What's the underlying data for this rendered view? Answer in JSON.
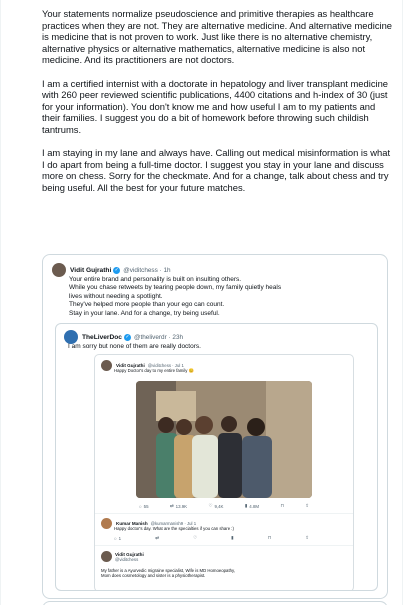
{
  "post": {
    "paragraphs": [
      "Your statements normalize pseudoscience and primitive therapies as healthcare practices when they are not. They are alternative medicine. And alternative medicine is medicine that is not proven to work. Just like there is no alternative chemistry, alternative physics or alternative mathematics, alternative medicine is also not medicine. And its practitioners are not doctors.",
      "I am a certified internist with a doctorate in hepatology and liver transplant medicine with 260 peer reviewed scientific publications, 4400 citations and h-index of 30 (just for your information). You don't know me and how useful I am to my patients and their families. I suggest you do a bit of homework before throwing such childish tantrums.",
      "I am staying in my lane and always have. Calling out medical misinformation is what I do apart from being a full-time doctor. I suggest you stay in your lane and discuss more on chess. Sorry for the checkmate. And for a change, talk about chess and try being useful. All the best for your future matches."
    ]
  },
  "quote": {
    "author": "Vidit Gujrathi",
    "handle": "@viditchess · 1h",
    "lines": [
      "Your entire brand and personality is built on insulting others.",
      "While you chase retweets by tearing people down, my family quietly heals",
      "lives without needing a spotlight.",
      "They've helped more people than your ego can count.",
      "Stay in your lane. And for a change, try being useful."
    ]
  },
  "inner": {
    "author": "TheLiverDoc",
    "handle": "@theliverdr · 23h",
    "text": "I am sorry but none of them are really doctors."
  },
  "nested": {
    "author": "Vidit Gujrathi",
    "handle": "@viditchess · Jul 1",
    "text": "Happy Doctor's day to my entire family 😊",
    "actions": [
      "55",
      "13.9K",
      "9,4K",
      "4.8M"
    ],
    "reply1": {
      "author": "Kumar Manish",
      "handle": "@kumarmanish9 · Jul 1",
      "text": "Happy doctor's day. What are the specialties if you can share :)",
      "actions": [
        "1",
        "",
        "",
        ""
      ]
    },
    "reply2": {
      "author": "Vidit Gujrathi",
      "handle": "@viditchess",
      "lines": [
        "My father is a Ayurvedic migraine specialist, Wife is MD Homoeopathy,",
        "Mom does cosmetology and sister is a physiotherapist."
      ]
    }
  }
}
